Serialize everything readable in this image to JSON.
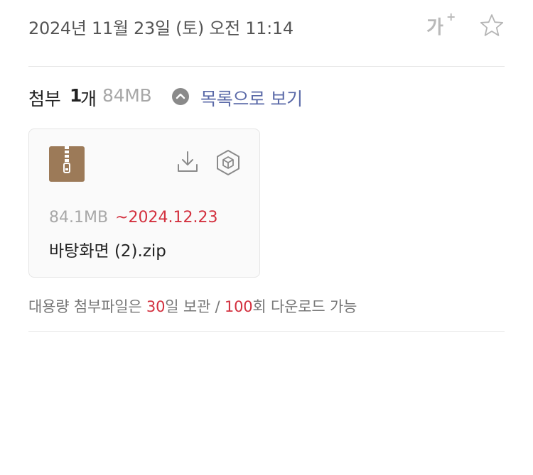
{
  "header": {
    "date": "2024년 11월 23일 (토) 오전 11:14",
    "font_size_label": "가",
    "font_size_plus": "+"
  },
  "attachments": {
    "label": "첨부",
    "count": "1",
    "count_unit": "개",
    "total_size": "84MB",
    "list_view_label": "목록으로 보기",
    "file": {
      "size": "84.1MB",
      "expiry": "~2024.12.23",
      "name": "바탕화면 (2).zip",
      "icon": "zip-archive-icon"
    },
    "notice": {
      "part1": "대용량 첨부파일은 ",
      "days": "30",
      "part2": "일 보관 / ",
      "downloads": "100",
      "part3": "회 다운로드 가능"
    }
  },
  "colors": {
    "accent_link": "#5b6aa8",
    "expiry_red": "#d3313f",
    "zip_brown": "#9c7a58"
  }
}
